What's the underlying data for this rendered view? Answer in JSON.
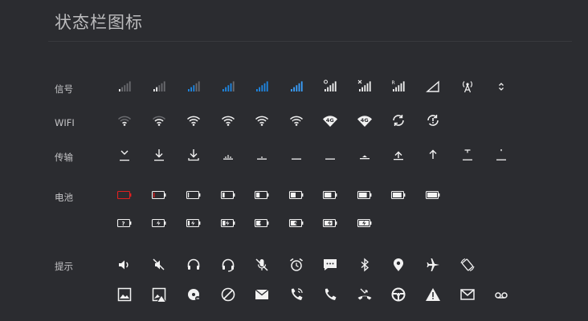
{
  "page": {
    "title": "状态栏图标"
  },
  "rows": [
    {
      "label": "信号",
      "icons": [
        "signal-bars-1-icon",
        "signal-bars-2-icon",
        "signal-bars-3-icon",
        "signal-bars-4-icon",
        "signal-bars-5-icon",
        "signal-bars-full-icon",
        "signal-search-icon",
        "signal-no-service-icon",
        "signal-roaming-icon",
        "signal-empty-triangle-icon",
        "antenna-icon",
        "data-arrows-icon"
      ]
    },
    {
      "label": "WIFI",
      "icons": [
        "wifi-1-icon",
        "wifi-2-icon",
        "wifi-3-icon",
        "wifi-4-icon",
        "wifi-full-icon",
        "wifi-data-icon",
        "wifi-4g-icon",
        "wifi-4g-alt-icon",
        "sync-icon",
        "sync-error-icon"
      ]
    },
    {
      "label": "传输",
      "icons": [
        "download-complete-icon",
        "download-icon",
        "download-tray-icon",
        "transfer-progress-1-icon",
        "transfer-progress-2-icon",
        "transfer-line-icon",
        "transfer-line-2-icon",
        "upload-tray-icon",
        "upload-icon",
        "upload-arrow-icon",
        "upload-progress-icon",
        "upload-dot-icon"
      ]
    },
    {
      "label": "电池",
      "icons": [
        "battery-critical-icon",
        "battery-low-icon",
        "battery-10-icon",
        "battery-20-icon",
        "battery-40-icon",
        "battery-50-icon",
        "battery-70-icon",
        "battery-80-icon",
        "battery-90-icon",
        "battery-full-icon"
      ]
    },
    {
      "label": "",
      "icons": [
        "battery-unknown-icon",
        "battery-charging-1-icon",
        "battery-charging-2-icon",
        "battery-charging-3-icon",
        "battery-charging-4-icon",
        "battery-charging-5-icon",
        "battery-charging-6-icon",
        "battery-charging-7-icon"
      ]
    },
    {
      "label": "提示",
      "icons": [
        "volume-icon",
        "mute-icon",
        "headset-icon",
        "headset-mic-icon",
        "mic-off-icon",
        "alarm-icon",
        "message-icon",
        "bluetooth-icon",
        "location-pin-icon",
        "airplane-icon",
        "rotate-icon"
      ]
    },
    {
      "label": "",
      "icons": [
        "image-icon",
        "image-warning-icon",
        "disc-icon",
        "blocked-icon",
        "email-icon",
        "phone-forward-icon",
        "phone-icon",
        "missed-call-icon",
        "steering-wheel-icon",
        "warning-icon",
        "gmail-icon",
        "voicemail-icon"
      ]
    }
  ],
  "colors": {
    "background": "#2b2c30",
    "icon": "#f2f2f2",
    "dim": "#6b6c70",
    "blue": "#1e88e5",
    "blueLight": "#3aa0ff",
    "red": "#e02020"
  }
}
